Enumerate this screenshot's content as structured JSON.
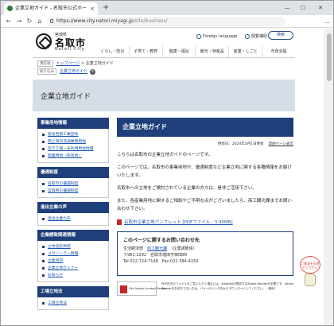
{
  "browser": {
    "tab_title": "企業立地ガイド - 名取市公式ホー",
    "tab_close": "×",
    "new_tab": "+",
    "window_controls": {
      "minimize": "—",
      "maximize": "☐",
      "close": "✕"
    },
    "nav": {
      "back": "←",
      "forward": "→",
      "reload": "↻",
      "home": "⌂"
    },
    "url_host": "https://www.city.natori.miyagi.jp",
    "url_path": "/site/business/",
    "menu": "…"
  },
  "header": {
    "logo_pref": "宮城県",
    "logo_city": "名取市",
    "logo_roman": "Natori City",
    "foreign_language": "Foreign language",
    "reading_support": "閲覧補助",
    "search_button": "検索"
  },
  "global_nav": [
    "くらし・防災",
    "子育て・教育",
    "健康・福祉",
    "観光・特産品",
    "産業・しごと",
    "市政全般"
  ],
  "breadcrumb": {
    "label": "現在地",
    "top": "トップページ",
    "sep": " > ",
    "current": "企業立地ガイド"
  },
  "tag": {
    "label": "絞り込み",
    "link": "企業立地ガイド",
    "clear": "×"
  },
  "page_title": "企業立地ガイド",
  "sidebar": [
    {
      "title": "事業用地情報",
      "items": [
        "愛島西部工業団地",
        "閖上海浜流通業務用地",
        "空き工場・未利用用地情報",
        "関連用地（民有地）"
      ]
    },
    {
      "title": "優遇制度",
      "items": [
        "名取市の優遇制度",
        "宮城県の優遇制度"
      ]
    },
    {
      "title": "進出企業の声",
      "items": [
        "進出企業の声"
      ]
    },
    {
      "title": "企業誘致関連情報",
      "items": [
        "立地協定締結",
        "メガソーラー情報",
        "企業見学",
        "企業立地セミナー",
        "お知らせ"
      ]
    },
    {
      "title": "工場立地法",
      "items": [
        "工場立地法"
      ]
    }
  ],
  "main": {
    "heading": "企業立地ガイド",
    "updated": "更新日：2024年3月1日更新",
    "print": "印刷ページ表示",
    "paragraphs": [
      "こちらは名取市の企業立地ガイドのページです。",
      "このページでは、名取市の事業用地や、優遇制度など企業立地に関する各種情報をお届けいたします。",
      "名取市への立地をご検討されている企業の方々は、是非ご活用下さい。",
      "また、各産業用地に関するご相談やご不明な点がございましたら、商工観光課までお問い合わせ下さい。"
    ],
    "pdf_link": "名取市企業立地パンフレット [PDFファイル／3.95MB]"
  },
  "contact": {
    "title": "このページに関するお問い合わせ先",
    "dept_prefix": "生活経済部",
    "dept_link": "商工観光課",
    "dept_suffix": "（企業誘致係）",
    "address": "〒981-1292　名取市増田字柳田80",
    "phone": "Tel:022-724-7148　Fax:022-384-4150"
  },
  "adobe": {
    "badge": "Get Adobe Acrobat Reader",
    "note": "PDF形式のファイルをご覧いただく場合には、Adobe社が提供するAdobe Readerが必要です。Adobe Readerをお持ちでない方は、バナーのリンク先からダウンロードしてください。（無料）"
  },
  "feedback": {
    "bubble": "ご意見をお寄せください"
  }
}
